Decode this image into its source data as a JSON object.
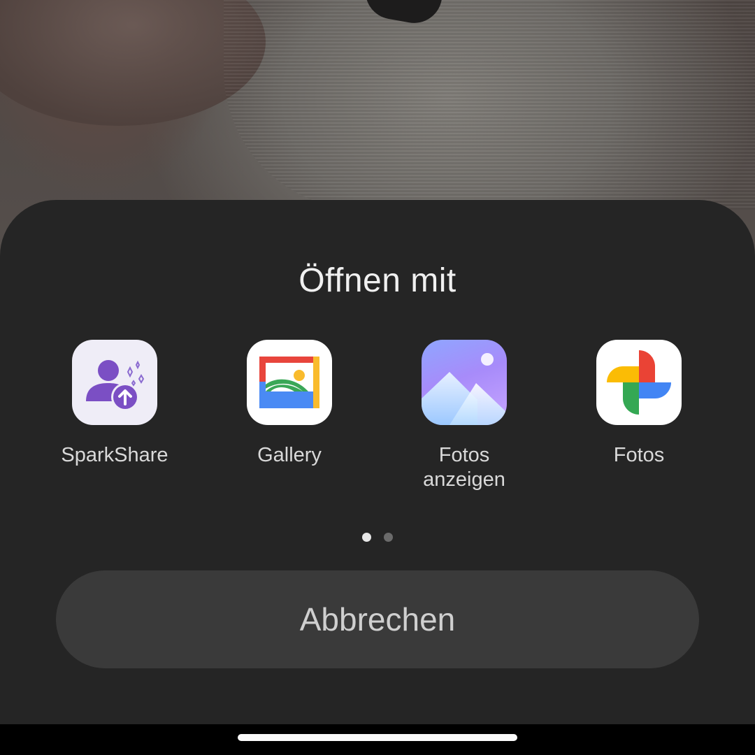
{
  "dialog": {
    "title": "Öffnen mit",
    "apps": [
      {
        "label": "SparkShare",
        "icon": "sparkshare-app-icon"
      },
      {
        "label": "Gallery",
        "icon": "gallery-app-icon"
      },
      {
        "label": "Fotos\nanzeigen",
        "icon": "fotos-anzeigen-app-icon"
      },
      {
        "label": "Fotos",
        "icon": "google-fotos-app-icon"
      }
    ],
    "pager": {
      "pages": 2,
      "current": 1
    },
    "cancel_label": "Abbrechen"
  },
  "colors": {
    "sheet_bg": "#252525",
    "cancel_bg": "#3a3a3a",
    "text_primary": "#f0f0f0",
    "text_secondary": "#d9d9d9"
  }
}
